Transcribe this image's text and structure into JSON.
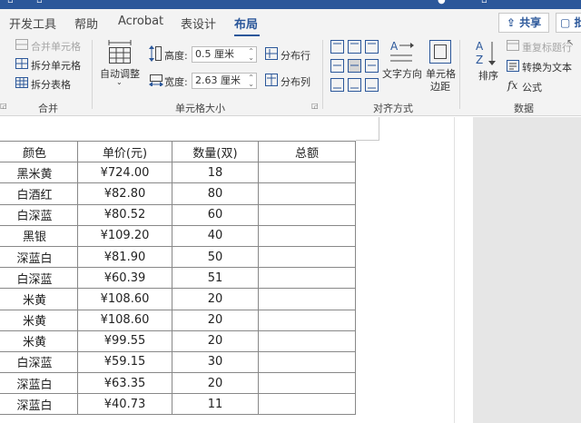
{
  "tabs": [
    {
      "label": "开发工具"
    },
    {
      "label": "帮助"
    },
    {
      "label": "Acrobat"
    },
    {
      "label": "表设计"
    },
    {
      "label": "布局"
    }
  ],
  "share_label": "共享",
  "comment_label": "批",
  "ribbon": {
    "merge": {
      "merge_cells": "合并单元格",
      "split_cells": "拆分单元格",
      "split_table": "拆分表格",
      "group_label": "合并"
    },
    "cell_size": {
      "autofit": "自动调整",
      "height_label": "高度:",
      "height_value": "0.5 厘米",
      "width_label": "宽度:",
      "width_value": "2.63 厘米",
      "distribute_rows": "分布行",
      "distribute_cols": "分布列",
      "group_label": "单元格大小"
    },
    "alignment": {
      "text_direction": "文字方向",
      "cell_margins_line1": "单元格",
      "cell_margins_line2": "边距",
      "group_label": "对齐方式"
    },
    "data": {
      "sort": "排序",
      "repeat_header": "重复标题行",
      "convert_text": "转换为文本",
      "formula": "公式",
      "group_label": "数据"
    }
  },
  "table": {
    "headers": [
      "颜色",
      "单价(元)",
      "数量(双)",
      "总额"
    ],
    "rows": [
      [
        "黑米黄",
        "¥724.00",
        "18",
        ""
      ],
      [
        "白酒红",
        "¥82.80",
        "80",
        ""
      ],
      [
        "白深蓝",
        "¥80.52",
        "60",
        ""
      ],
      [
        "黑银",
        "¥109.20",
        "40",
        ""
      ],
      [
        "深蓝白",
        "¥81.90",
        "50",
        ""
      ],
      [
        "白深蓝",
        "¥60.39",
        "51",
        ""
      ],
      [
        "米黄",
        "¥108.60",
        "20",
        ""
      ],
      [
        "米黄",
        "¥108.60",
        "20",
        ""
      ],
      [
        "米黄",
        "¥99.55",
        "20",
        ""
      ],
      [
        "白深蓝",
        "¥59.15",
        "30",
        ""
      ],
      [
        "深蓝白",
        "¥63.35",
        "20",
        ""
      ],
      [
        "深蓝白",
        "¥40.73",
        "11",
        ""
      ]
    ]
  }
}
